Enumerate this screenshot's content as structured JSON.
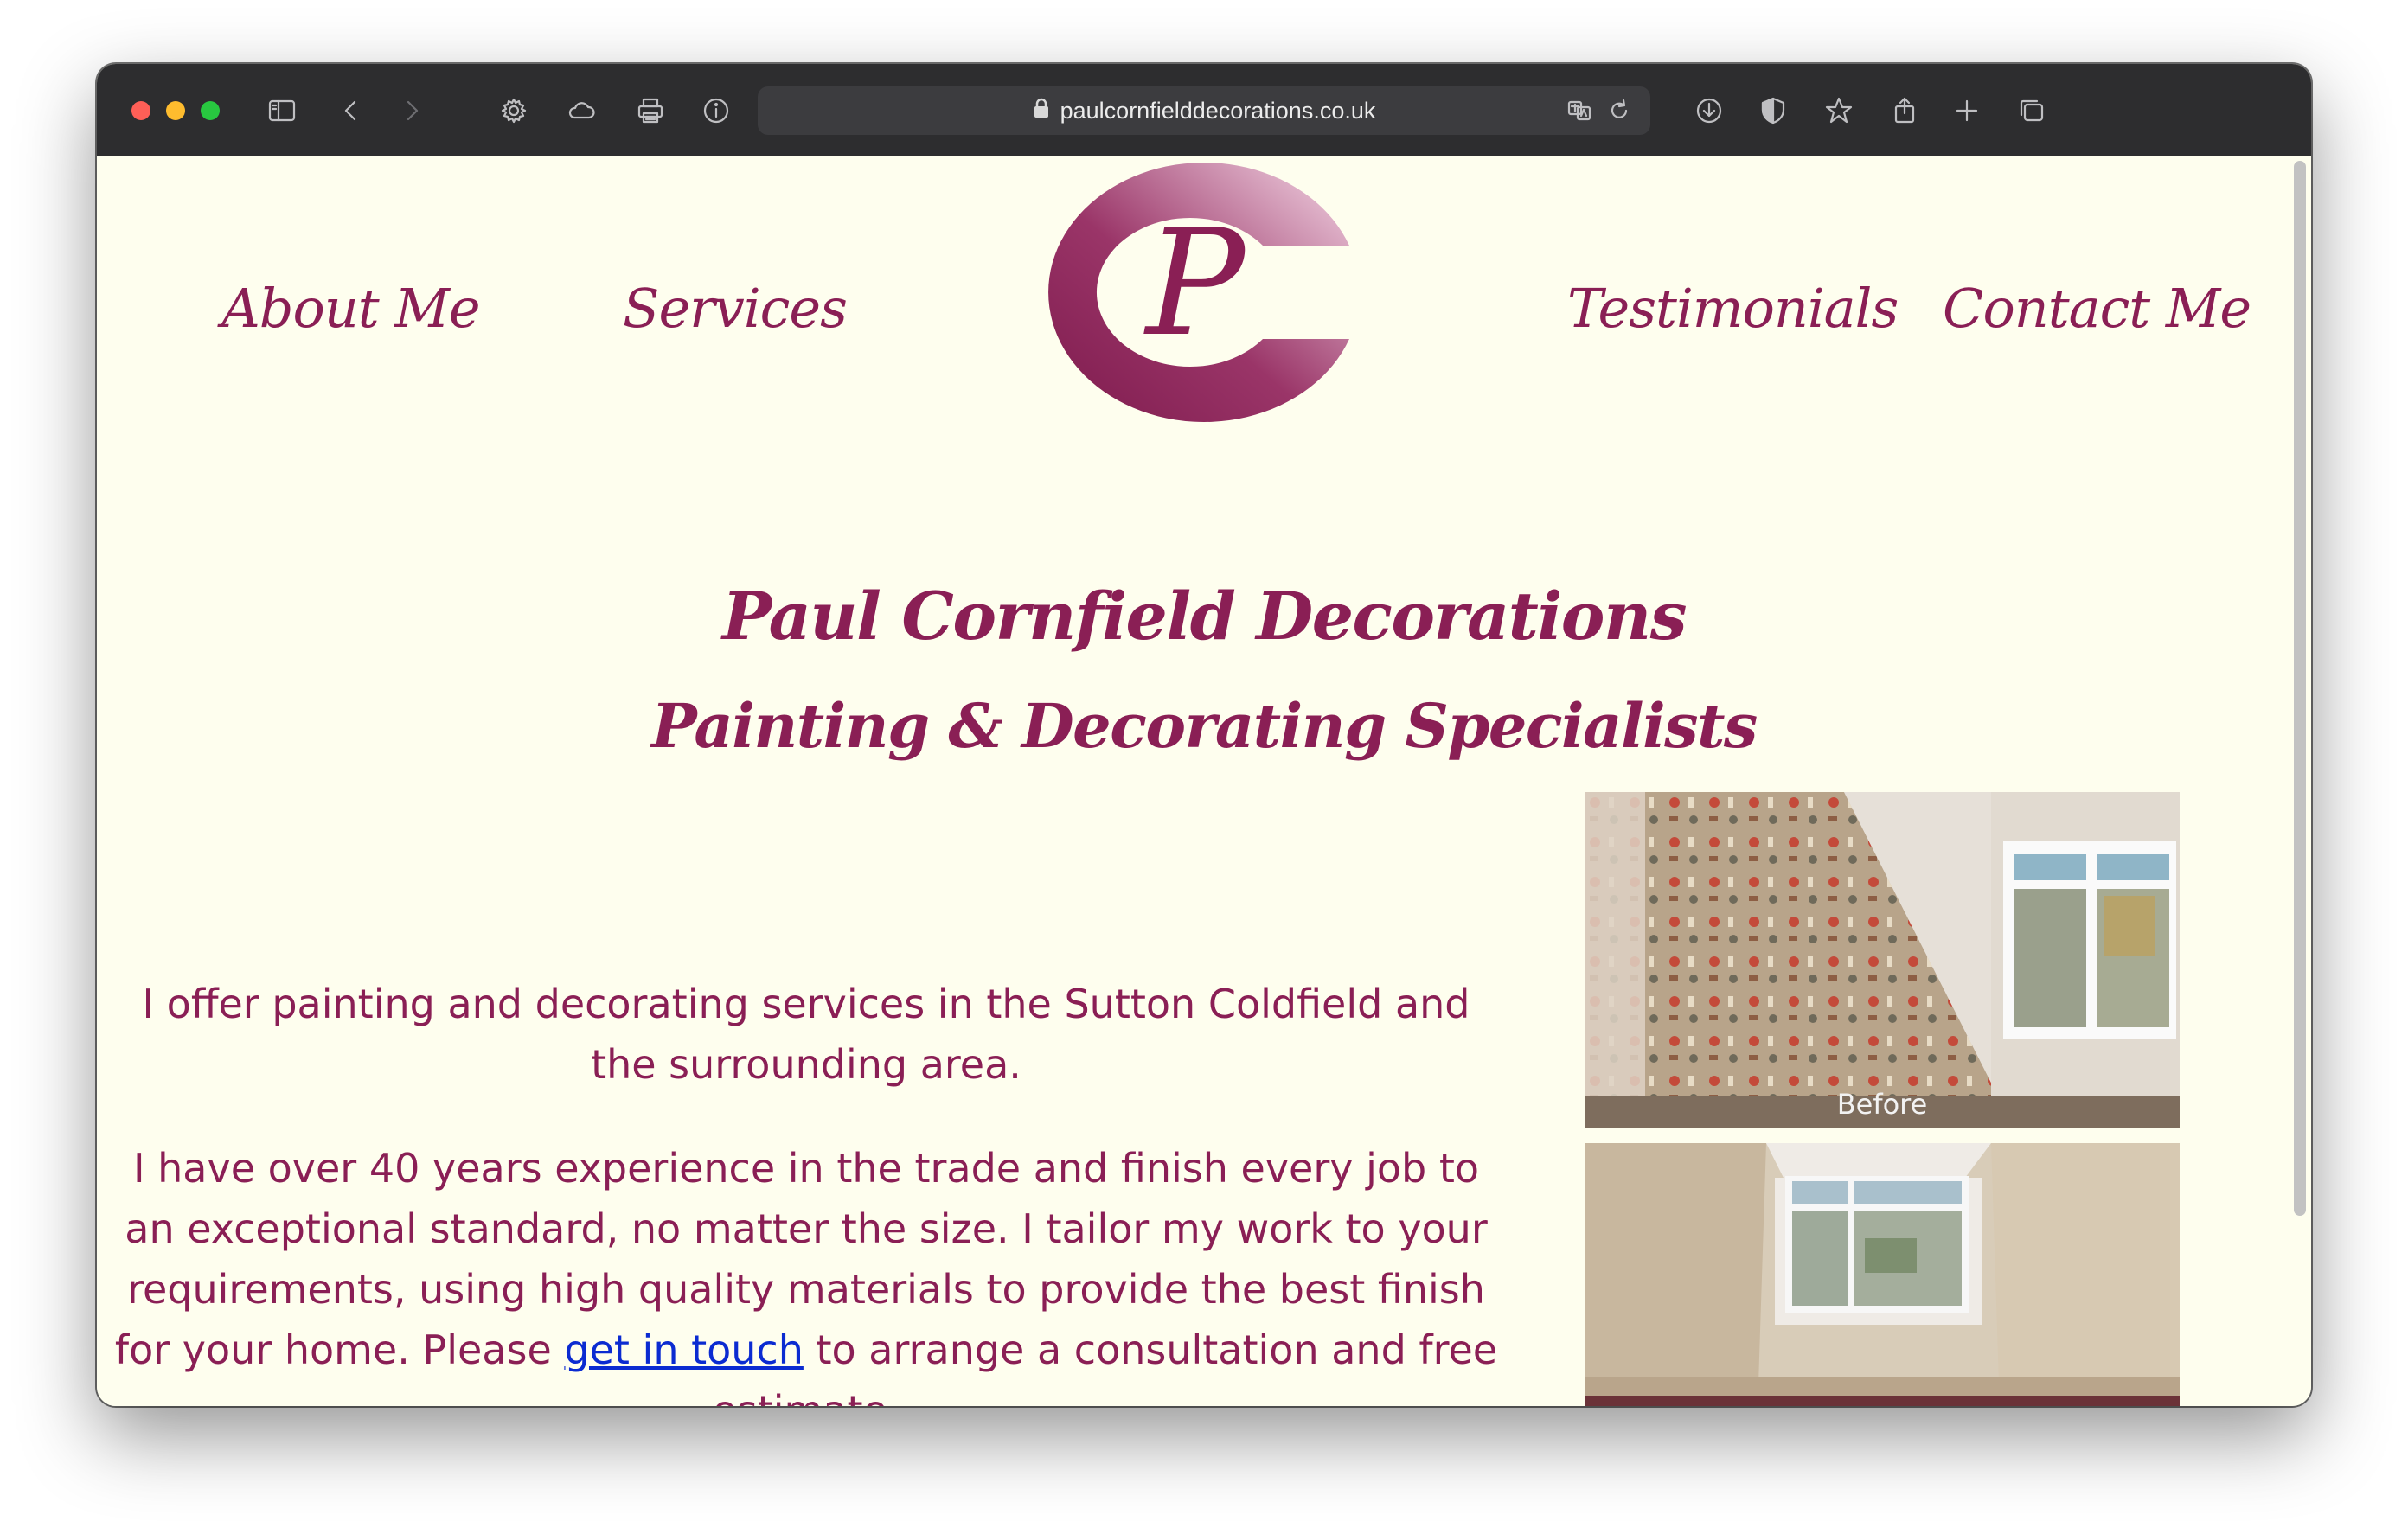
{
  "browser": {
    "url": "paulcornfielddecorations.co.uk"
  },
  "nav": {
    "about": "About Me",
    "services": "Services",
    "testimonials": "Testimonials",
    "contact": "Contact Me"
  },
  "logo": {
    "letter": "P"
  },
  "heading": {
    "title": "Paul Cornfield Decorations",
    "subtitle": "Painting & Decorating Specialists"
  },
  "intro": {
    "p1": "I offer painting and decorating services in the Sutton Coldfield and the surrounding area.",
    "p2_before": "I have over 40 years experience in the trade and finish every job to an exceptional standard, no matter the size. I tailor my work to your requirements, using high quality materials to provide the best finish for your home. Please ",
    "p2_link": "get in touch",
    "p2_after": " to arrange a consultation and free estimate."
  },
  "gallery": {
    "before_caption": "Before"
  },
  "colors": {
    "brand": "#8a1f55",
    "background": "#fefeee",
    "link": "#0b2bd1"
  }
}
